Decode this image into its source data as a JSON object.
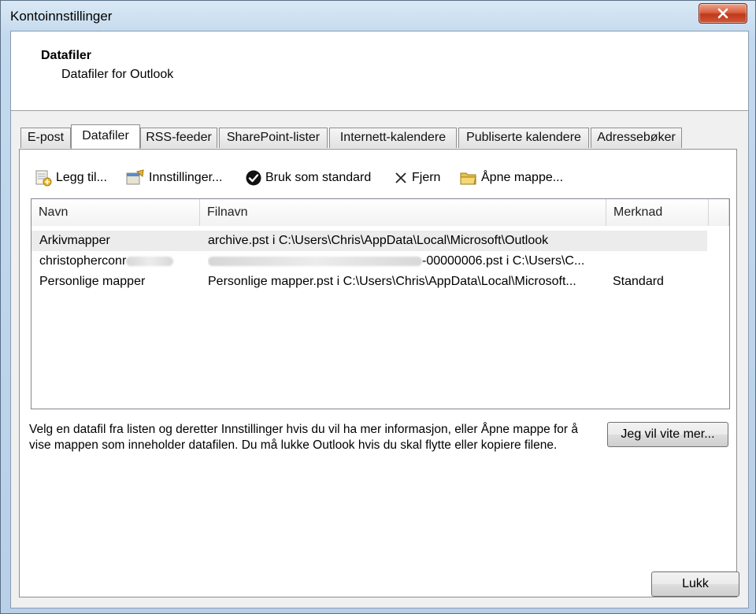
{
  "window": {
    "title": "Kontoinnstillinger"
  },
  "header": {
    "title": "Datafiler",
    "subtitle": "Datafiler for Outlook"
  },
  "tabs": [
    {
      "label": "E-post"
    },
    {
      "label": "Datafiler"
    },
    {
      "label": "RSS-feeder"
    },
    {
      "label": "SharePoint-lister"
    },
    {
      "label": "Internett-kalendere"
    },
    {
      "label": "Publiserte kalendere"
    },
    {
      "label": "Adressebøker"
    }
  ],
  "active_tab": "Datafiler",
  "toolbar": {
    "add": "Legg til...",
    "settings": "Innstillinger...",
    "set_default": "Bruk som standard",
    "remove": "Fjern",
    "open_folder": "Åpne mappe..."
  },
  "list": {
    "columns": {
      "name": "Navn",
      "filename": "Filnavn",
      "comment": "Merknad"
    },
    "rows": [
      {
        "name": "Arkivmapper",
        "filename": "archive.pst i C:\\Users\\Chris\\AppData\\Local\\Microsoft\\Outlook",
        "comment": ""
      },
      {
        "name": "christopherconr",
        "filename": "-00000006.pst i C:\\Users\\C...",
        "comment": ""
      },
      {
        "name": "Personlige mapper",
        "filename": "Personlige mapper.pst i C:\\Users\\Chris\\AppData\\Local\\Microsoft...",
        "comment": "Standard"
      }
    ]
  },
  "description": "Velg en datafil fra listen og deretter Innstillinger hvis du vil ha mer informasjon, eller Åpne mappe for å vise mappen som inneholder datafilen. Du må lukke Outlook hvis du skal flytte eller kopiere filene.",
  "buttons": {
    "learn_more": "Jeg vil vite mer...",
    "close": "Lukk"
  }
}
